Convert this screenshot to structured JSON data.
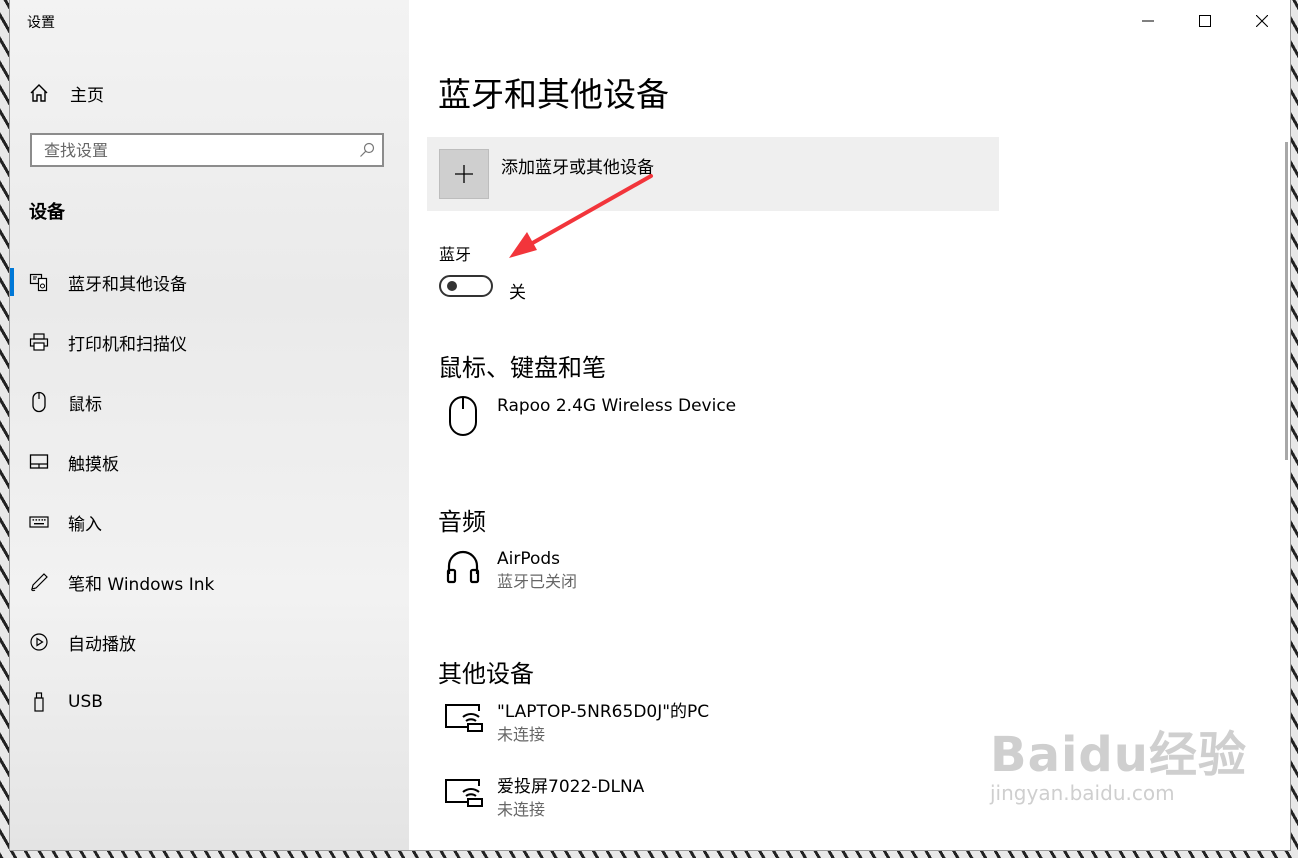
{
  "window": {
    "title": "设置",
    "controls": [
      "minimize-icon",
      "maximize-icon",
      "close-icon"
    ]
  },
  "sidebar": {
    "home_label": "主页",
    "search_placeholder": "查找设置",
    "section_title": "设备",
    "items": [
      {
        "label": "蓝牙和其他设备",
        "icon": "bluetooth-devices-icon",
        "active": true
      },
      {
        "label": "打印机和扫描仪",
        "icon": "printer-icon",
        "active": false
      },
      {
        "label": "鼠标",
        "icon": "mouse-icon",
        "active": false
      },
      {
        "label": "触摸板",
        "icon": "touchpad-icon",
        "active": false
      },
      {
        "label": "输入",
        "icon": "keyboard-icon",
        "active": false
      },
      {
        "label": "笔和 Windows Ink",
        "icon": "pen-icon",
        "active": false
      },
      {
        "label": "自动播放",
        "icon": "autoplay-icon",
        "active": false
      },
      {
        "label": "USB",
        "icon": "usb-icon",
        "active": false
      }
    ]
  },
  "main": {
    "page_title": "蓝牙和其他设备",
    "add_device_label": "添加蓝牙或其他设备",
    "bluetooth": {
      "label": "蓝牙",
      "state_label": "关",
      "on": false
    },
    "groups": [
      {
        "title": "鼠标、键盘和笔",
        "devices": [
          {
            "name": "Rapoo 2.4G Wireless Device",
            "status": "",
            "icon": "mouse-icon"
          }
        ]
      },
      {
        "title": "音频",
        "devices": [
          {
            "name": "AirPods",
            "status": "蓝牙已关闭",
            "icon": "headphones-icon"
          }
        ]
      },
      {
        "title": "其他设备",
        "devices": [
          {
            "name": "\"LAPTOP-5NR65D0J\"的PC",
            "status": "未连接",
            "icon": "wireless-display-icon"
          },
          {
            "name": "爱投屏7022-DLNA",
            "status": "未连接",
            "icon": "wireless-display-icon"
          }
        ]
      }
    ]
  },
  "colors": {
    "accent": "#0078d7",
    "annotation_arrow": "#f2353b"
  },
  "watermark": {
    "logo": "Baidu经验",
    "url": "jingyan.baidu.com"
  }
}
